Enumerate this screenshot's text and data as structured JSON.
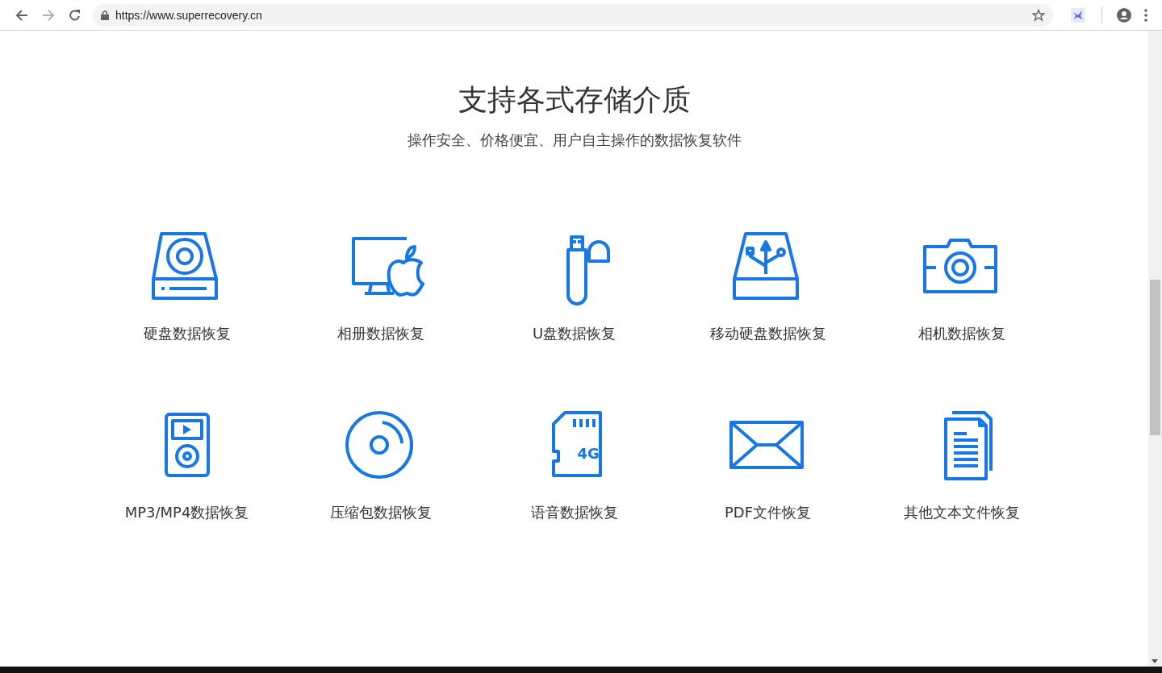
{
  "browser": {
    "url": "https://www.superrecovery.cn"
  },
  "section": {
    "title": "支持各式存储介质",
    "subtitle": "操作安全、价格便宜、用户自主操作的数据恢复软件"
  },
  "items": [
    {
      "kind": "hdd",
      "label": "硬盘数据恢复"
    },
    {
      "kind": "mac",
      "label": "相册数据恢复"
    },
    {
      "kind": "usb",
      "label": "U盘数据恢复"
    },
    {
      "kind": "portable",
      "label": "移动硬盘数据恢复"
    },
    {
      "kind": "camera",
      "label": "相机数据恢复"
    },
    {
      "kind": "player",
      "label": "MP3/MP4数据恢复"
    },
    {
      "kind": "disc",
      "label": "压缩包数据恢复"
    },
    {
      "kind": "sdcard",
      "label": "语音数据恢复",
      "icon_text": "4G"
    },
    {
      "kind": "envelope",
      "label": "PDF文件恢复"
    },
    {
      "kind": "document",
      "label": "其他文本文件恢复"
    }
  ]
}
